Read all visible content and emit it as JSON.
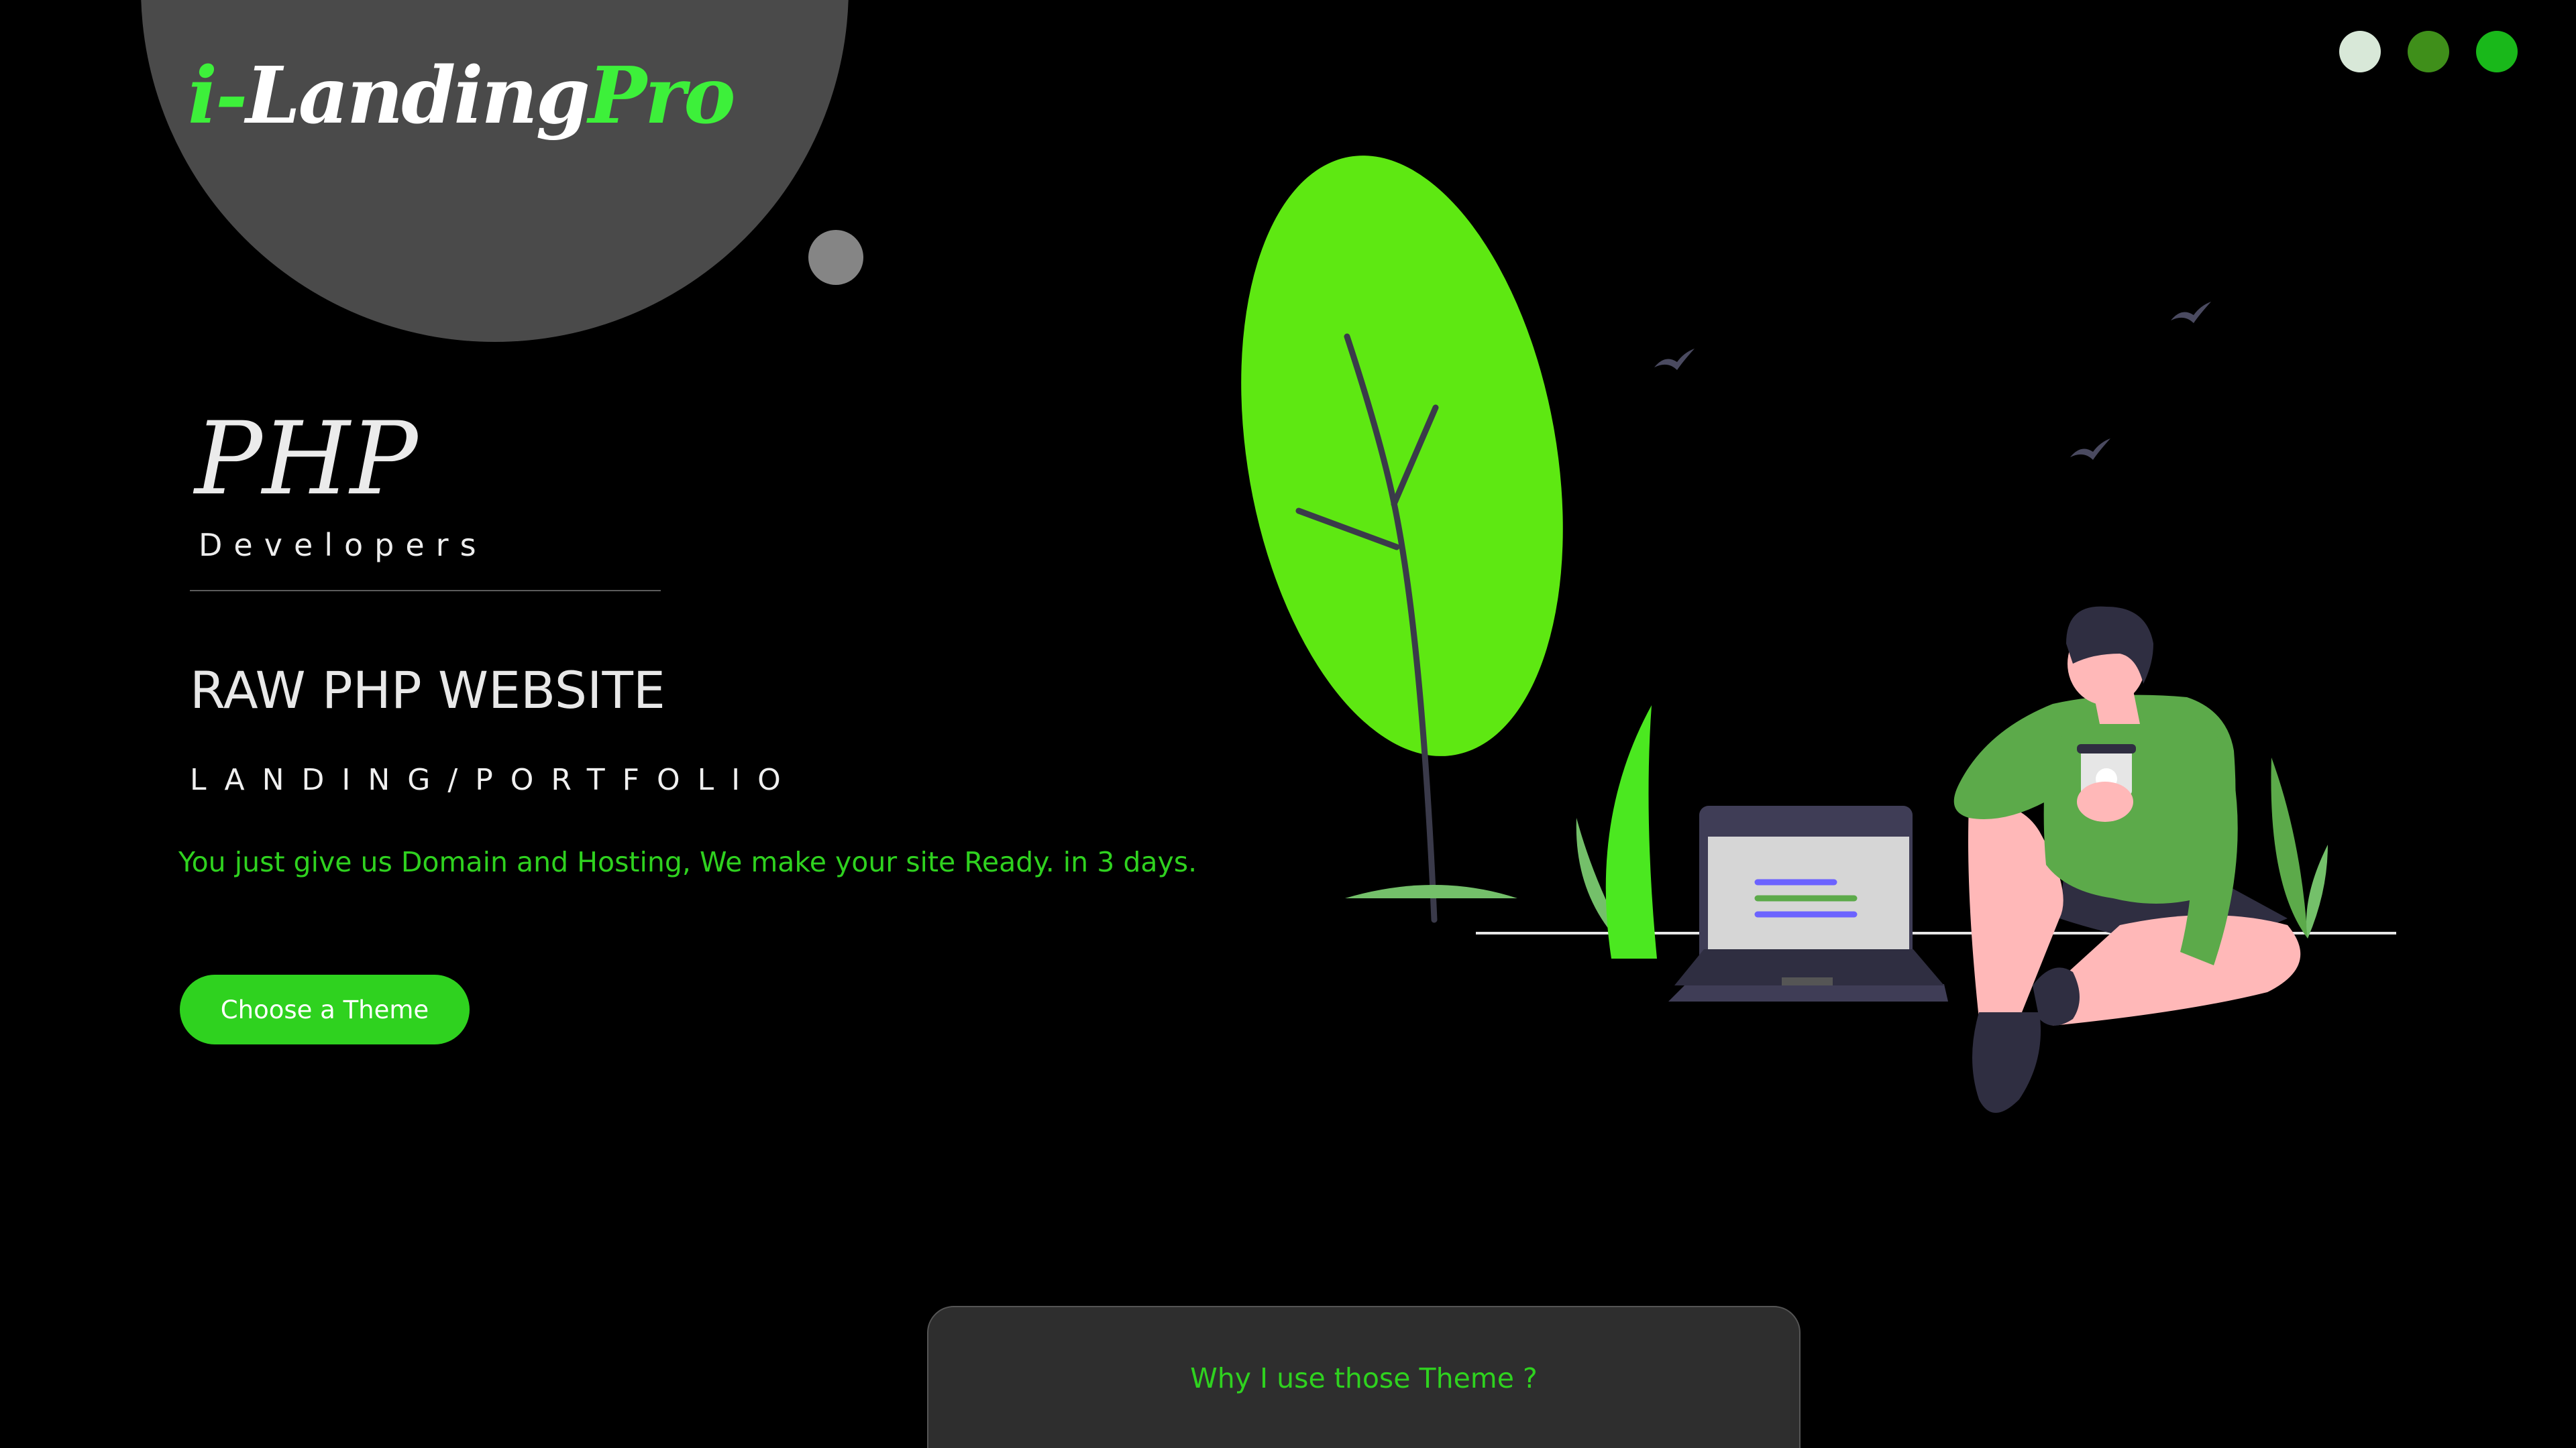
{
  "logo": {
    "prefix": "i-",
    "main": "Landing",
    "suffix": "Pro"
  },
  "theme_switcher": {
    "dots": [
      {
        "name": "light",
        "color": "#d8e8d8"
      },
      {
        "name": "olive",
        "color": "#3f8f1a"
      },
      {
        "name": "green",
        "color": "#19b81a"
      }
    ]
  },
  "hero": {
    "title": "PHP",
    "subtitle": "Developers",
    "heading": "RAW PHP WEBSITE",
    "subheading": "LANDING/PORTFOLIO",
    "tagline": "You just give us Domain and Hosting, We make your site Ready. in 3 days.",
    "cta_label": "Choose a Theme"
  },
  "why_section": {
    "title": "Why I use those Theme ?"
  },
  "colors": {
    "accent": "#2fd21f",
    "background": "#000000",
    "circle": "#4a4a4a",
    "card": "#2e2e2e"
  },
  "icons": [
    "leaf-tree-icon",
    "bird-icon",
    "laptop-icon",
    "person-with-coffee-icon",
    "grass-icon"
  ]
}
